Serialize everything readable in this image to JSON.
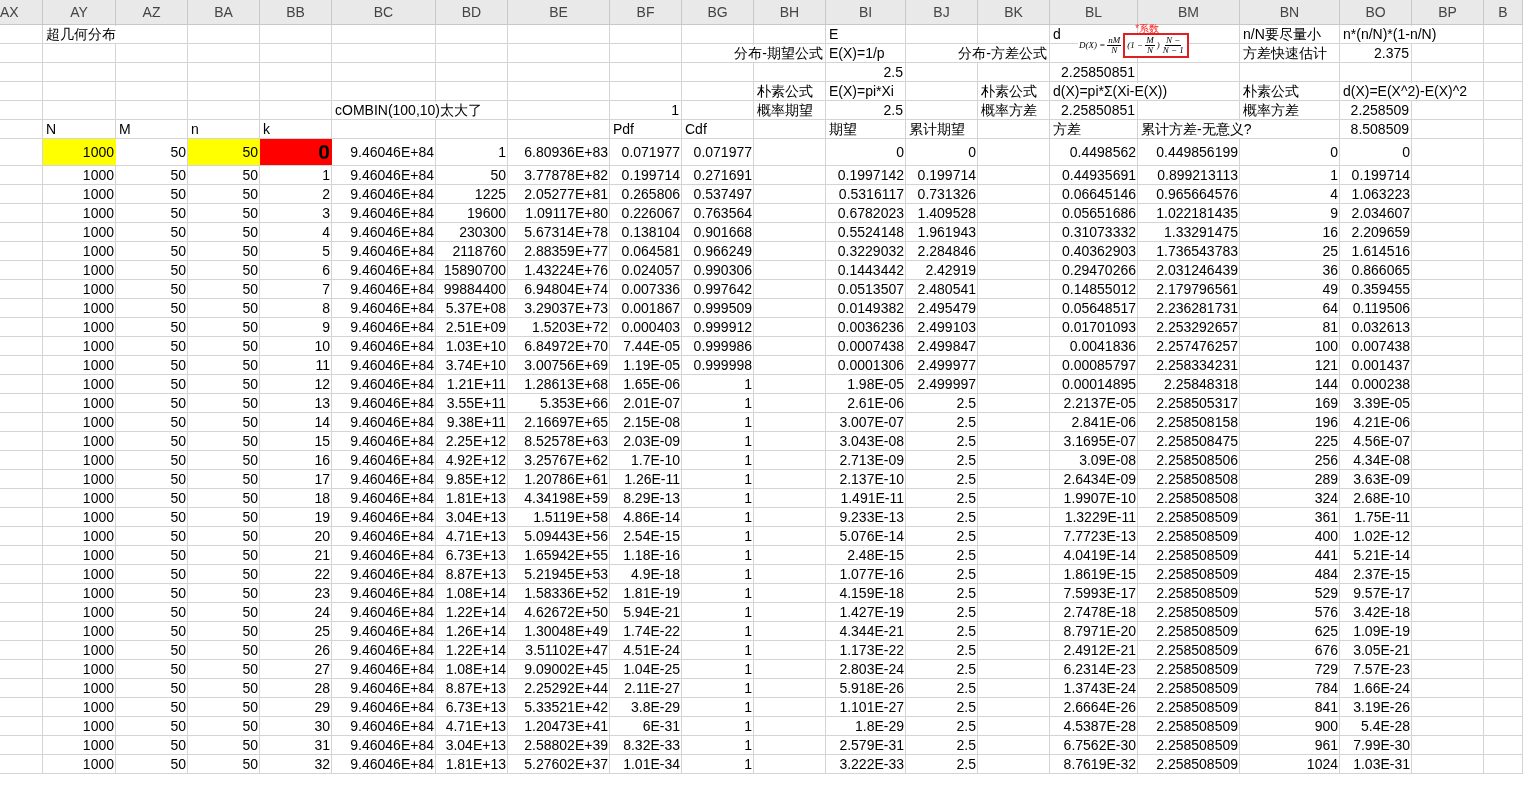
{
  "column_headers": [
    "AX",
    "AY",
    "AZ",
    "BA",
    "BB",
    "BC",
    "BD",
    "BE",
    "BF",
    "BG",
    "BH",
    "BI",
    "BJ",
    "BK",
    "BL",
    "BM",
    "BN",
    "BO",
    "BP",
    "B"
  ],
  "formula": {
    "note": "*系数",
    "parts": [
      {
        "kind": "text",
        "text": "D(X) =",
        "boxed": false
      },
      {
        "kind": "frac",
        "num": "nM",
        "den": "N",
        "boxed": false
      },
      {
        "kind": "text",
        "text": "(1 −",
        "boxed": true
      },
      {
        "kind": "frac",
        "num": "M",
        "den": "N",
        "boxed": true
      },
      {
        "kind": "text",
        "text": ")",
        "boxed": true
      },
      {
        "kind": "frac",
        "num": "N −",
        "den": "N − 1",
        "boxed": true
      }
    ]
  },
  "header_rows": [
    [
      {
        "text": "超几何分布",
        "kind": "label"
      },
      null,
      null,
      null,
      null,
      null,
      null,
      null,
      null,
      null,
      {
        "text": "E",
        "kind": "label"
      },
      null,
      null,
      {
        "text": "d",
        "kind": "label"
      },
      null,
      {
        "text": "n/N要尽量小",
        "kind": "label"
      },
      {
        "text": "n*(n/N)*(1-n/N)",
        "kind": "label"
      }
    ],
    [
      null,
      null,
      null,
      null,
      null,
      null,
      null,
      null,
      null,
      {
        "text": "分布-期望公式",
        "kind": "number"
      },
      {
        "text": "E(X)=1/p",
        "kind": "label"
      },
      null,
      {
        "text": "分布-方差公式",
        "kind": "number"
      },
      null,
      null,
      {
        "text": "方差快速估计",
        "kind": "label"
      },
      {
        "text": "2.375",
        "kind": "number"
      }
    ],
    [
      null,
      null,
      null,
      null,
      null,
      null,
      null,
      null,
      null,
      null,
      {
        "text": "2.5",
        "kind": "number"
      },
      null,
      null,
      {
        "text": "2.25850851",
        "kind": "number"
      },
      null,
      null,
      null
    ],
    [
      null,
      null,
      null,
      null,
      null,
      null,
      null,
      null,
      null,
      {
        "text": "朴素公式",
        "kind": "label"
      },
      {
        "text": "E(X)=pi*Xi",
        "kind": "label"
      },
      null,
      {
        "text": "朴素公式",
        "kind": "label"
      },
      {
        "text": "d(X)=pi*Σ(Xi-E(X))",
        "kind": "label"
      },
      null,
      {
        "text": "朴素公式",
        "kind": "label"
      },
      {
        "text": "d(X)=E(X^2)-E(X)^2",
        "kind": "label"
      }
    ],
    [
      null,
      null,
      null,
      null,
      {
        "text": "cOMBIN(100,10)太大了",
        "kind": "label"
      },
      null,
      null,
      {
        "text": "1",
        "kind": "number"
      },
      null,
      {
        "text": "概率期望",
        "kind": "label"
      },
      {
        "text": "2.5",
        "kind": "number"
      },
      null,
      {
        "text": "概率方差",
        "kind": "label"
      },
      {
        "text": "2.25850851",
        "kind": "number"
      },
      null,
      {
        "text": "概率方差",
        "kind": "label"
      },
      {
        "text": "2.258509",
        "kind": "number"
      }
    ],
    [
      {
        "text": "N",
        "kind": "label"
      },
      {
        "text": "M",
        "kind": "label"
      },
      {
        "text": "n",
        "kind": "label"
      },
      {
        "text": "k",
        "kind": "label"
      },
      null,
      null,
      null,
      {
        "text": "Pdf",
        "kind": "label"
      },
      {
        "text": "Cdf",
        "kind": "label"
      },
      null,
      {
        "text": "期望",
        "kind": "label"
      },
      {
        "text": "累计期望",
        "kind": "label"
      },
      null,
      {
        "text": "方差",
        "kind": "label"
      },
      {
        "text": "累计方差-无意义?",
        "kind": "label"
      },
      null,
      {
        "text": "8.508509",
        "kind": "number"
      }
    ]
  ],
  "rows": [
    {
      "cells": [
        {
          "text": "1000",
          "color": "#ffff00",
          "emphasis": false
        },
        "50",
        {
          "text": "50",
          "color": "#ffff00",
          "emphasis": false
        },
        {
          "text": "0",
          "color": "#ff0000",
          "emphasis": true
        },
        "9.46046E+84",
        "1",
        "6.80936E+83",
        "0.071977",
        "0.071977",
        null,
        "0",
        "0",
        null,
        "0.4498562",
        "0.449856199",
        "0",
        "0"
      ]
    },
    {
      "cells": [
        "1000",
        "50",
        "50",
        "1",
        "9.46046E+84",
        "50",
        "3.77878E+82",
        "0.199714",
        "0.271691",
        null,
        "0.1997142",
        "0.199714",
        null,
        "0.44935691",
        "0.899213113",
        "1",
        "0.199714"
      ]
    },
    {
      "cells": [
        "1000",
        "50",
        "50",
        "2",
        "9.46046E+84",
        "1225",
        "2.05277E+81",
        "0.265806",
        "0.537497",
        null,
        "0.5316117",
        "0.731326",
        null,
        "0.06645146",
        "0.965664576",
        "4",
        "1.063223"
      ]
    },
    {
      "cells": [
        "1000",
        "50",
        "50",
        "3",
        "9.46046E+84",
        "19600",
        "1.09117E+80",
        "0.226067",
        "0.763564",
        null,
        "0.6782023",
        "1.409528",
        null,
        "0.05651686",
        "1.022181435",
        "9",
        "2.034607"
      ]
    },
    {
      "cells": [
        "1000",
        "50",
        "50",
        "4",
        "9.46046E+84",
        "230300",
        "5.67314E+78",
        "0.138104",
        "0.901668",
        null,
        "0.5524148",
        "1.961943",
        null,
        "0.31073332",
        "1.33291475",
        "16",
        "2.209659"
      ]
    },
    {
      "cells": [
        "1000",
        "50",
        "50",
        "5",
        "9.46046E+84",
        "2118760",
        "2.88359E+77",
        "0.064581",
        "0.966249",
        null,
        "0.3229032",
        "2.284846",
        null,
        "0.40362903",
        "1.736543783",
        "25",
        "1.614516"
      ]
    },
    {
      "cells": [
        "1000",
        "50",
        "50",
        "6",
        "9.46046E+84",
        "15890700",
        "1.43224E+76",
        "0.024057",
        "0.990306",
        null,
        "0.1443442",
        "2.42919",
        null,
        "0.29470266",
        "2.031246439",
        "36",
        "0.866065"
      ]
    },
    {
      "cells": [
        "1000",
        "50",
        "50",
        "7",
        "9.46046E+84",
        "99884400",
        "6.94804E+74",
        "0.007336",
        "0.997642",
        null,
        "0.0513507",
        "2.480541",
        null,
        "0.14855012",
        "2.179796561",
        "49",
        "0.359455"
      ]
    },
    {
      "cells": [
        "1000",
        "50",
        "50",
        "8",
        "9.46046E+84",
        "5.37E+08",
        "3.29037E+73",
        "0.001867",
        "0.999509",
        null,
        "0.0149382",
        "2.495479",
        null,
        "0.05648517",
        "2.236281731",
        "64",
        "0.119506"
      ]
    },
    {
      "cells": [
        "1000",
        "50",
        "50",
        "9",
        "9.46046E+84",
        "2.51E+09",
        "1.5203E+72",
        "0.000403",
        "0.999912",
        null,
        "0.0036236",
        "2.499103",
        null,
        "0.01701093",
        "2.253292657",
        "81",
        "0.032613"
      ]
    },
    {
      "cells": [
        "1000",
        "50",
        "50",
        "10",
        "9.46046E+84",
        "1.03E+10",
        "6.84972E+70",
        "7.44E-05",
        "0.999986",
        null,
        "0.0007438",
        "2.499847",
        null,
        "0.0041836",
        "2.257476257",
        "100",
        "0.007438"
      ]
    },
    {
      "cells": [
        "1000",
        "50",
        "50",
        "11",
        "9.46046E+84",
        "3.74E+10",
        "3.00756E+69",
        "1.19E-05",
        "0.999998",
        null,
        "0.0001306",
        "2.499977",
        null,
        "0.00085797",
        "2.258334231",
        "121",
        "0.001437"
      ]
    },
    {
      "cells": [
        "1000",
        "50",
        "50",
        "12",
        "9.46046E+84",
        "1.21E+11",
        "1.28613E+68",
        "1.65E-06",
        "1",
        null,
        "1.98E-05",
        "2.499997",
        null,
        "0.00014895",
        "2.25848318",
        "144",
        "0.000238"
      ]
    },
    {
      "cells": [
        "1000",
        "50",
        "50",
        "13",
        "9.46046E+84",
        "3.55E+11",
        "5.353E+66",
        "2.01E-07",
        "1",
        null,
        "2.61E-06",
        "2.5",
        null,
        "2.2137E-05",
        "2.258505317",
        "169",
        "3.39E-05"
      ]
    },
    {
      "cells": [
        "1000",
        "50",
        "50",
        "14",
        "9.46046E+84",
        "9.38E+11",
        "2.16697E+65",
        "2.15E-08",
        "1",
        null,
        "3.007E-07",
        "2.5",
        null,
        "2.841E-06",
        "2.258508158",
        "196",
        "4.21E-06"
      ]
    },
    {
      "cells": [
        "1000",
        "50",
        "50",
        "15",
        "9.46046E+84",
        "2.25E+12",
        "8.52578E+63",
        "2.03E-09",
        "1",
        null,
        "3.043E-08",
        "2.5",
        null,
        "3.1695E-07",
        "2.258508475",
        "225",
        "4.56E-07"
      ]
    },
    {
      "cells": [
        "1000",
        "50",
        "50",
        "16",
        "9.46046E+84",
        "4.92E+12",
        "3.25767E+62",
        "1.7E-10",
        "1",
        null,
        "2.713E-09",
        "2.5",
        null,
        "3.09E-08",
        "2.258508506",
        "256",
        "4.34E-08"
      ]
    },
    {
      "cells": [
        "1000",
        "50",
        "50",
        "17",
        "9.46046E+84",
        "9.85E+12",
        "1.20786E+61",
        "1.26E-11",
        "1",
        null,
        "2.137E-10",
        "2.5",
        null,
        "2.6434E-09",
        "2.258508508",
        "289",
        "3.63E-09"
      ]
    },
    {
      "cells": [
        "1000",
        "50",
        "50",
        "18",
        "9.46046E+84",
        "1.81E+13",
        "4.34198E+59",
        "8.29E-13",
        "1",
        null,
        "1.491E-11",
        "2.5",
        null,
        "1.9907E-10",
        "2.258508508",
        "324",
        "2.68E-10"
      ]
    },
    {
      "cells": [
        "1000",
        "50",
        "50",
        "19",
        "9.46046E+84",
        "3.04E+13",
        "1.5119E+58",
        "4.86E-14",
        "1",
        null,
        "9.233E-13",
        "2.5",
        null,
        "1.3229E-11",
        "2.258508509",
        "361",
        "1.75E-11"
      ]
    },
    {
      "cells": [
        "1000",
        "50",
        "50",
        "20",
        "9.46046E+84",
        "4.71E+13",
        "5.09443E+56",
        "2.54E-15",
        "1",
        null,
        "5.076E-14",
        "2.5",
        null,
        "7.7723E-13",
        "2.258508509",
        "400",
        "1.02E-12"
      ]
    },
    {
      "cells": [
        "1000",
        "50",
        "50",
        "21",
        "9.46046E+84",
        "6.73E+13",
        "1.65942E+55",
        "1.18E-16",
        "1",
        null,
        "2.48E-15",
        "2.5",
        null,
        "4.0419E-14",
        "2.258508509",
        "441",
        "5.21E-14"
      ]
    },
    {
      "cells": [
        "1000",
        "50",
        "50",
        "22",
        "9.46046E+84",
        "8.87E+13",
        "5.21945E+53",
        "4.9E-18",
        "1",
        null,
        "1.077E-16",
        "2.5",
        null,
        "1.8619E-15",
        "2.258508509",
        "484",
        "2.37E-15"
      ]
    },
    {
      "cells": [
        "1000",
        "50",
        "50",
        "23",
        "9.46046E+84",
        "1.08E+14",
        "1.58336E+52",
        "1.81E-19",
        "1",
        null,
        "4.159E-18",
        "2.5",
        null,
        "7.5993E-17",
        "2.258508509",
        "529",
        "9.57E-17"
      ]
    },
    {
      "cells": [
        "1000",
        "50",
        "50",
        "24",
        "9.46046E+84",
        "1.22E+14",
        "4.62672E+50",
        "5.94E-21",
        "1",
        null,
        "1.427E-19",
        "2.5",
        null,
        "2.7478E-18",
        "2.258508509",
        "576",
        "3.42E-18"
      ]
    },
    {
      "cells": [
        "1000",
        "50",
        "50",
        "25",
        "9.46046E+84",
        "1.26E+14",
        "1.30048E+49",
        "1.74E-22",
        "1",
        null,
        "4.344E-21",
        "2.5",
        null,
        "8.7971E-20",
        "2.258508509",
        "625",
        "1.09E-19"
      ]
    },
    {
      "cells": [
        "1000",
        "50",
        "50",
        "26",
        "9.46046E+84",
        "1.22E+14",
        "3.51102E+47",
        "4.51E-24",
        "1",
        null,
        "1.173E-22",
        "2.5",
        null,
        "2.4912E-21",
        "2.258508509",
        "676",
        "3.05E-21"
      ]
    },
    {
      "cells": [
        "1000",
        "50",
        "50",
        "27",
        "9.46046E+84",
        "1.08E+14",
        "9.09002E+45",
        "1.04E-25",
        "1",
        null,
        "2.803E-24",
        "2.5",
        null,
        "6.2314E-23",
        "2.258508509",
        "729",
        "7.57E-23"
      ]
    },
    {
      "cells": [
        "1000",
        "50",
        "50",
        "28",
        "9.46046E+84",
        "8.87E+13",
        "2.25292E+44",
        "2.11E-27",
        "1",
        null,
        "5.918E-26",
        "2.5",
        null,
        "1.3743E-24",
        "2.258508509",
        "784",
        "1.66E-24"
      ]
    },
    {
      "cells": [
        "1000",
        "50",
        "50",
        "29",
        "9.46046E+84",
        "6.73E+13",
        "5.33521E+42",
        "3.8E-29",
        "1",
        null,
        "1.101E-27",
        "2.5",
        null,
        "2.6664E-26",
        "2.258508509",
        "841",
        "3.19E-26"
      ]
    },
    {
      "cells": [
        "1000",
        "50",
        "50",
        "30",
        "9.46046E+84",
        "4.71E+13",
        "1.20473E+41",
        "6E-31",
        "1",
        null,
        "1.8E-29",
        "2.5",
        null,
        "4.5387E-28",
        "2.258508509",
        "900",
        "5.4E-28"
      ]
    },
    {
      "cells": [
        "1000",
        "50",
        "50",
        "31",
        "9.46046E+84",
        "3.04E+13",
        "2.58802E+39",
        "8.32E-33",
        "1",
        null,
        "2.579E-31",
        "2.5",
        null,
        "6.7562E-30",
        "2.258508509",
        "961",
        "7.99E-30"
      ]
    },
    {
      "cells": [
        "1000",
        "50",
        "50",
        "32",
        "9.46046E+84",
        "1.81E+13",
        "5.27602E+37",
        "1.01E-34",
        "1",
        null,
        "3.222E-33",
        "2.5",
        null,
        "8.7619E-32",
        "2.258508509",
        "1024",
        "1.03E-31"
      ]
    }
  ]
}
